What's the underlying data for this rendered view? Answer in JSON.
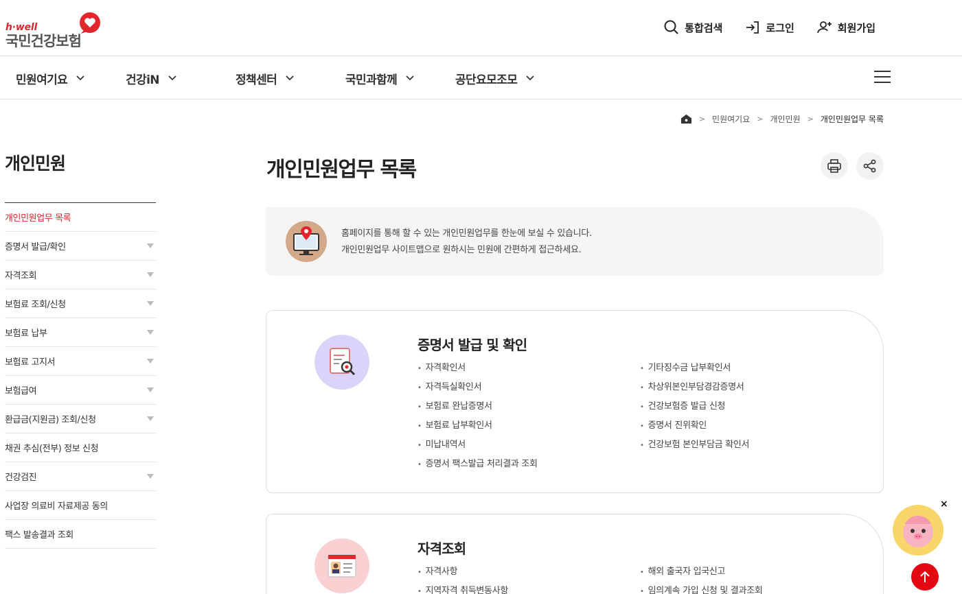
{
  "logo": {
    "en": "h·well",
    "ko": "국민건강보험"
  },
  "util": [
    {
      "label": "통합검색",
      "icon": "search-icon"
    },
    {
      "label": "로그인",
      "icon": "login-icon"
    },
    {
      "label": "회원가입",
      "icon": "user-plus-icon"
    }
  ],
  "gnb": [
    {
      "label": "민원여기요"
    },
    {
      "label": "건강iN"
    },
    {
      "label": "정책센터"
    },
    {
      "label": "국민과함께"
    },
    {
      "label": "공단요모조모"
    }
  ],
  "breadcrumb": {
    "home_icon": "home-icon",
    "items": [
      "민원여기요",
      "개인민원"
    ],
    "current": "개인민원업무 목록"
  },
  "lnb": {
    "title": "개인민원",
    "items": [
      {
        "label": "개인민원업무 목록"
      },
      {
        "label": "증명서 발급/확인"
      },
      {
        "label": "자격조회"
      },
      {
        "label": "보험료 조회/신청"
      },
      {
        "label": "보험료 납부"
      },
      {
        "label": "보험료 고지서"
      },
      {
        "label": "보험급여"
      },
      {
        "label": "환급금(지원금) 조회/신청"
      },
      {
        "label": "채권 추심(전부) 정보 신청"
      },
      {
        "label": "건강검진"
      },
      {
        "label": "사업장 의료비 자료제공 동의"
      },
      {
        "label": "팩스 발송결과 조회"
      }
    ]
  },
  "content": {
    "title": "개인민원업무 목록",
    "intro_line1": "홈페이지를 통해 할 수 있는 개인민원업무를 한눈에 보실 수 있습니다.",
    "intro_line2": "개인민원업무 사이트맵으로 원하시는 민원에 간편하게 접근하세요."
  },
  "cards": [
    {
      "title": "증명서 발급 및 확인",
      "col1": [
        "자격확인서",
        "자격득실확인서",
        "보험료 완납증명서",
        "보험료 납부확인서",
        "미납내역서",
        "증명서 팩스발급 처리결과 조회"
      ],
      "col2": [
        "기타징수금 납부확인서",
        "차상위본인부담경감증명서",
        "건강보험증 발급 신청",
        "증명서 진위확인",
        "건강보험 본인부담금 확인서"
      ]
    },
    {
      "title": "자격조회",
      "col1": [
        "자격사항",
        "지역자격 취득변동사항"
      ],
      "col2": [
        "해외 출국자 입국신고",
        "임의계속 가입 신청 및 결과조회"
      ]
    }
  ],
  "colors": {
    "accent": "#d7262d",
    "top_button": "#e30613",
    "chatbot_bg": "#f9d66a"
  }
}
